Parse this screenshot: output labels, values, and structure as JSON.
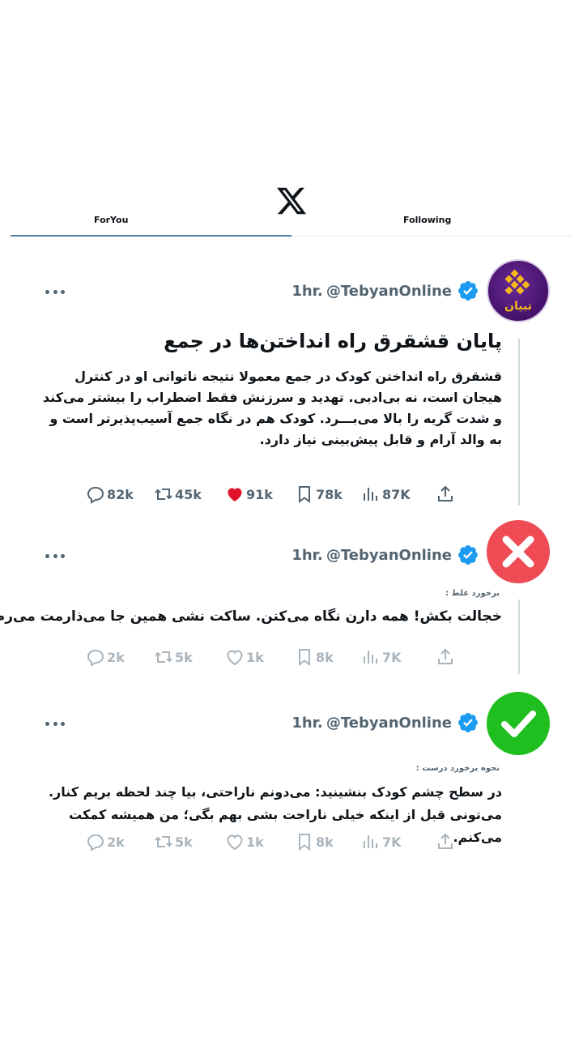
{
  "header": {
    "logo": "x-logo",
    "tabs": [
      {
        "label": "ForYou"
      },
      {
        "label": "Following"
      }
    ]
  },
  "tweets": [
    {
      "avatar": "tebyan-logo",
      "avatar_text": "تبیان",
      "time": "1hr.",
      "handle": "@TebyanOnline",
      "title": "پایان قشقرق راه انداختن‌ها در جمع",
      "body": "قشقرق راه انداختن کودک در جمع معمولا نتیجه ناتوانی او در کنترل هیجان است، نه بی‌ادبی. تهدید و سرزنش فقط اضطراب را بیشتر می‌کند و شدت گریه را بالا می‌بـــرد. کودک هم در نگاه جمع آسیب‌پذیرتر است و به والد آرام و قابل پیش‌بینی نیاز دارد.",
      "stats": {
        "replies": "82k",
        "retweets": "45k",
        "likes": "91k",
        "bookmarks": "78k",
        "views": "87K"
      }
    },
    {
      "avatar": "wrong-x-icon",
      "time": "1hr.",
      "handle": "@TebyanOnline",
      "label": "برخورد غلط :",
      "body": "خجالت بکش! همه دارن نگاه می‌کنن. ساکت نشی همین جا می‌ذارمت می‌رم...",
      "stats": {
        "replies": "2k",
        "retweets": "5k",
        "likes": "1k",
        "bookmarks": "8k",
        "views": "7K"
      }
    },
    {
      "avatar": "correct-check-icon",
      "time": "1hr.",
      "handle": "@TebyanOnline",
      "label": "نحوه برخورد درست :",
      "body": "در سطح چشم کودک بنشینید: می‌دونم ناراحتی، بیا چند لحظه بریم کنار. می‌تونی قبل از اینکه خیلی ناراحت بشی بهم بگی؛ من همیشه کمکت می‌کنم.",
      "stats": {
        "replies": "2k",
        "retweets": "5k",
        "likes": "1k",
        "bookmarks": "8k",
        "views": "7K"
      }
    }
  ],
  "colors": {
    "verified": "#1d9bf0",
    "like": "#f91880",
    "wrong": "#ee4b55",
    "right": "#1fbf1f",
    "tebyan_purple": "#4a1570",
    "tebyan_gold": "#f5b81c"
  }
}
